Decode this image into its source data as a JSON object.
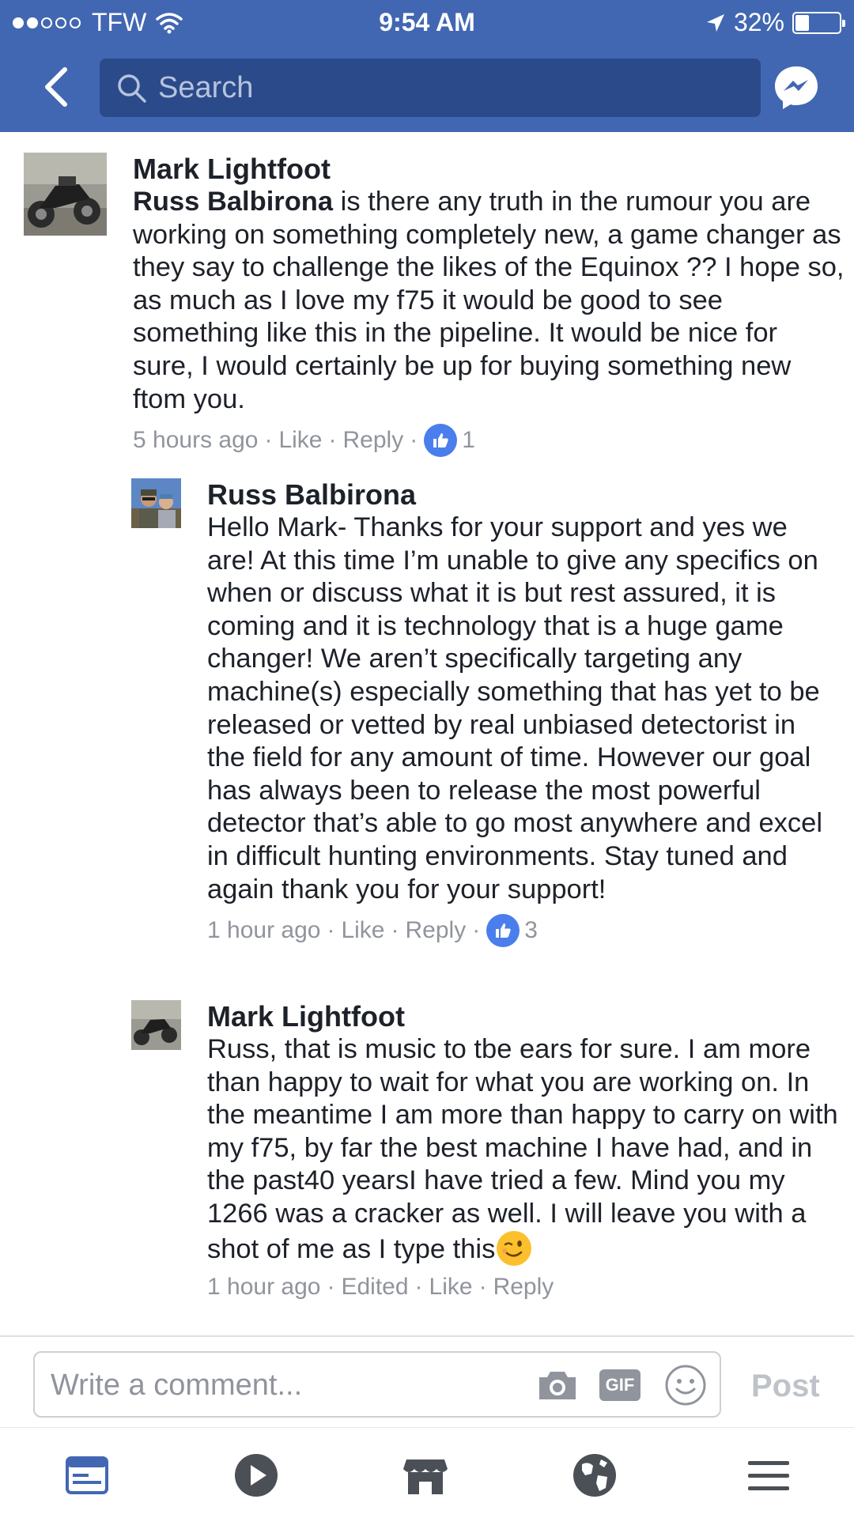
{
  "status_bar": {
    "carrier": "TFW",
    "time": "9:54 AM",
    "battery": "32%",
    "battery_level": 0.32,
    "signal_bars_filled": 2,
    "signal_bars_total": 5
  },
  "header": {
    "search_placeholder": "Search",
    "accent_color": "#4267b2"
  },
  "comments": [
    {
      "author": "Mark Lightfoot",
      "mention": "Russ Balbirona",
      "text": " is there any truth in the rumour you are working on something completely new, a game changer as they say to challenge the likes of the Equinox ?? I hope so, as much as I love my f75 it would be good to see something like this in the pipeline. It would be nice for sure, I would certainly be up for buying something new ftom you.",
      "time": "5 hours ago",
      "like_label": "Like",
      "reply_label": "Reply",
      "like_count": "1"
    },
    {
      "author": "Russ Balbirona",
      "text": "Hello Mark- Thanks for your support and yes we are! At this time I’m unable to give any specifics on when or discuss what it is but rest assured, it is coming and it is technology that is a huge game changer! We aren’t specifically targeting any machine(s) especially something that has yet to be released or vetted by real unbiased detectorist in the field for any amount of time. However our goal has always been to release the most powerful detector that’s able to go most anywhere and excel in difficult hunting environments. Stay tuned and again thank you for your support!",
      "time": "1 hour ago",
      "like_label": "Like",
      "reply_label": "Reply",
      "like_count": "3"
    },
    {
      "author": "Mark Lightfoot",
      "text": "Russ, that is music to tbe ears for sure. I am more than happy to wait for what you are working on. In the meantime I am more than happy to carry on with my f75, by far the best machine I have had, and in the past40 yearsI have tried a few. Mind you my 1266 was a cracker as well. I will leave you with a shot of me as I type this",
      "emoji": "winking-face",
      "time": "1 hour ago",
      "edited_label": "Edited",
      "like_label": "Like",
      "reply_label": "Reply"
    }
  ],
  "composer": {
    "placeholder": "Write a comment...",
    "gif_label": "GIF",
    "post_label": "Post"
  },
  "tabbar": {
    "tabs": [
      "news-feed-icon",
      "video-icon",
      "marketplace-icon",
      "notifications-globe-icon",
      "menu-icon"
    ]
  }
}
